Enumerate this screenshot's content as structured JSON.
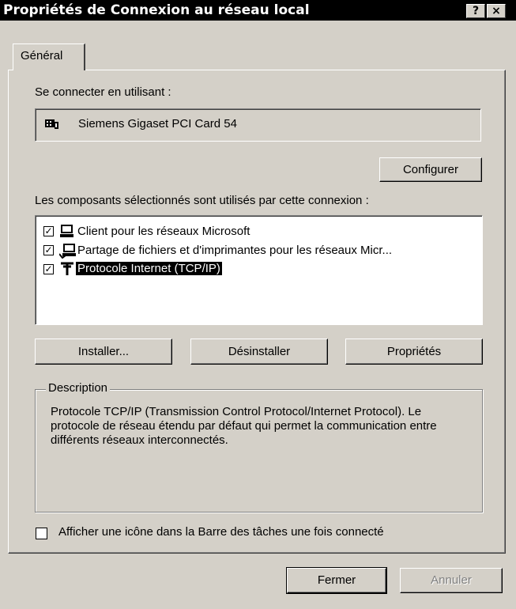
{
  "window": {
    "title": "Propriétés de Connexion au réseau local",
    "help_button": "?",
    "close_button": "×"
  },
  "tabs": [
    {
      "label": "Général",
      "active": true
    }
  ],
  "connect_using": {
    "label": "Se connecter en utilisant :",
    "device": "Siemens Gigaset PCI Card 54",
    "device_icon": "network-card-icon",
    "configure_button": "Configurer"
  },
  "components": {
    "label": "Les composants sélectionnés sont utilisés par cette connexion :",
    "items": [
      {
        "label": "Client pour les réseaux Microsoft",
        "checked": true,
        "icon": "computer-icon",
        "selected": false
      },
      {
        "label": "Partage de fichiers et d'imprimantes pour les réseaux Micr...",
        "checked": true,
        "icon": "share-computer-icon",
        "selected": false
      },
      {
        "label": "Protocole Internet (TCP/IP)",
        "checked": true,
        "icon": "protocol-icon",
        "selected": true
      }
    ],
    "install_button": "Installer...",
    "uninstall_button": "Désinstaller",
    "properties_button": "Propriétés"
  },
  "description": {
    "legend": "Description",
    "text": "Protocole TCP/IP (Transmission Control Protocol/Internet Protocol). Le protocole de réseau étendu par défaut qui permet la communication entre différents réseaux interconnectés."
  },
  "tray_checkbox": {
    "label": "Afficher une icône dans la Barre des tâches une fois connecté",
    "checked": false
  },
  "footer": {
    "close_button": "Fermer",
    "cancel_button": "Annuler"
  }
}
